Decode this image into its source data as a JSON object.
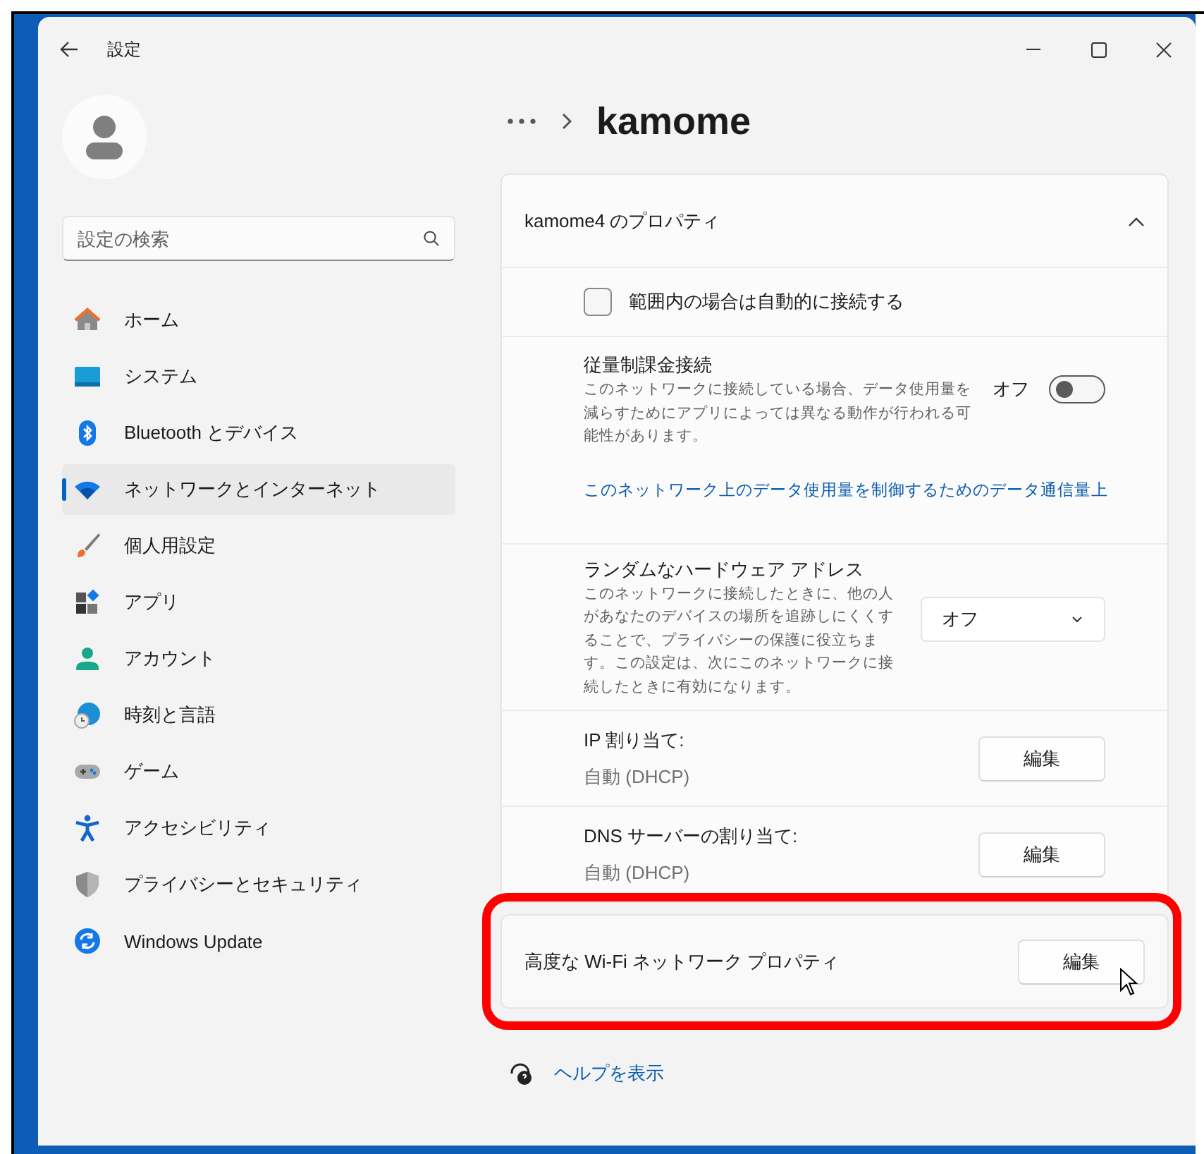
{
  "window": {
    "title": "設定"
  },
  "sidebar": {
    "search": {
      "placeholder": "設定の検索"
    },
    "items": [
      {
        "label": "ホーム",
        "selected": false
      },
      {
        "label": "システム",
        "selected": false
      },
      {
        "label": "Bluetooth とデバイス",
        "selected": false
      },
      {
        "label": "ネットワークとインターネット",
        "selected": true
      },
      {
        "label": "個人用設定",
        "selected": false
      },
      {
        "label": "アプリ",
        "selected": false
      },
      {
        "label": "アカウント",
        "selected": false
      },
      {
        "label": "時刻と言語",
        "selected": false
      },
      {
        "label": "ゲーム",
        "selected": false
      },
      {
        "label": "アクセシビリティ",
        "selected": false
      },
      {
        "label": "プライバシーとセキュリティ",
        "selected": false
      },
      {
        "label": "Windows Update",
        "selected": false
      }
    ]
  },
  "page_title": "kamome",
  "properties_card": {
    "title": "kamome4 のプロパティ",
    "expanded": true,
    "rows": [
      {
        "kind": "checkbox",
        "label": "範囲内の場合は自動的に接続する",
        "checked": false
      },
      {
        "kind": "toggle",
        "title": "従量制課金接続",
        "description": "このネットワークに接続している場合、データ使用量を減らすためにアプリによっては異なる動作が行われる可能性があります。",
        "state_label": "オフ",
        "on": false,
        "link": "このネットワーク上のデータ使用量を制御するためのデータ通信量上"
      },
      {
        "kind": "dropdown",
        "title": "ランダムなハードウェア アドレス",
        "description": "このネットワークに接続したときに、他の人があなたのデバイスの場所を追跡しにくくすることで、プライバシーの保護に役立ちます。この設定は、次にこのネットワークに接続したときに有効になります。",
        "value": "オフ"
      },
      {
        "kind": "edit",
        "title": "IP 割り当て:",
        "value": "自動 (DHCP)",
        "button": "編集"
      },
      {
        "kind": "edit",
        "title": "DNS サーバーの割り当て:",
        "value": "自動 (DHCP)",
        "button": "編集"
      }
    ]
  },
  "advanced": {
    "label": "高度な Wi-Fi ネットワーク プロパティ",
    "button": "編集",
    "highlighted": true
  },
  "help": {
    "link": "ヘルプを表示"
  }
}
